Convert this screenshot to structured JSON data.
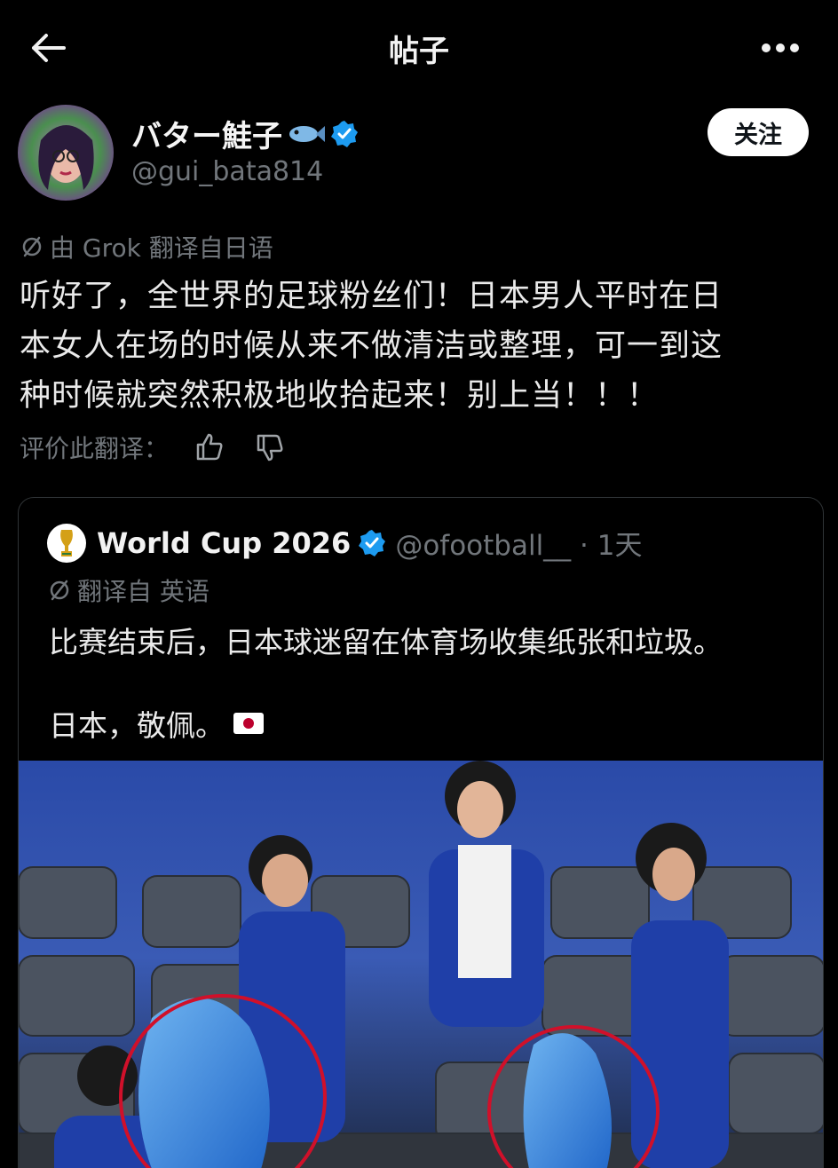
{
  "topbar": {
    "title": "帖子",
    "back_icon": "arrow-left-icon",
    "more_icon": "more-horizontal-icon"
  },
  "author": {
    "name": "バター鮭子",
    "handle": "@gui_bata814",
    "verified_color": "#1d9bf0",
    "follow_label": "关注"
  },
  "translation": {
    "notice": "由 Grok 翻译自日语",
    "text_lines": [
      "听好了，全世界的足球粉丝们！日本男人平时在日",
      "本女人在场的时候从来不做清洁或整理，可一到这",
      "种时候就突然积极地收拾起来！别上当！！！"
    ],
    "rate_label": "评价此翻译："
  },
  "quote": {
    "name": "World Cup 2026",
    "handle": "@ofootball__ · 1天",
    "translate_note": "翻译自 英语",
    "text1": "比赛结束后，日本球迷留在体育场收集纸张和垃圾。",
    "text2": "日本，敬佩。"
  },
  "colors": {
    "background": "#000000",
    "muted": "#71767b",
    "accent": "#1d9bf0",
    "circle": "#d0102a"
  }
}
